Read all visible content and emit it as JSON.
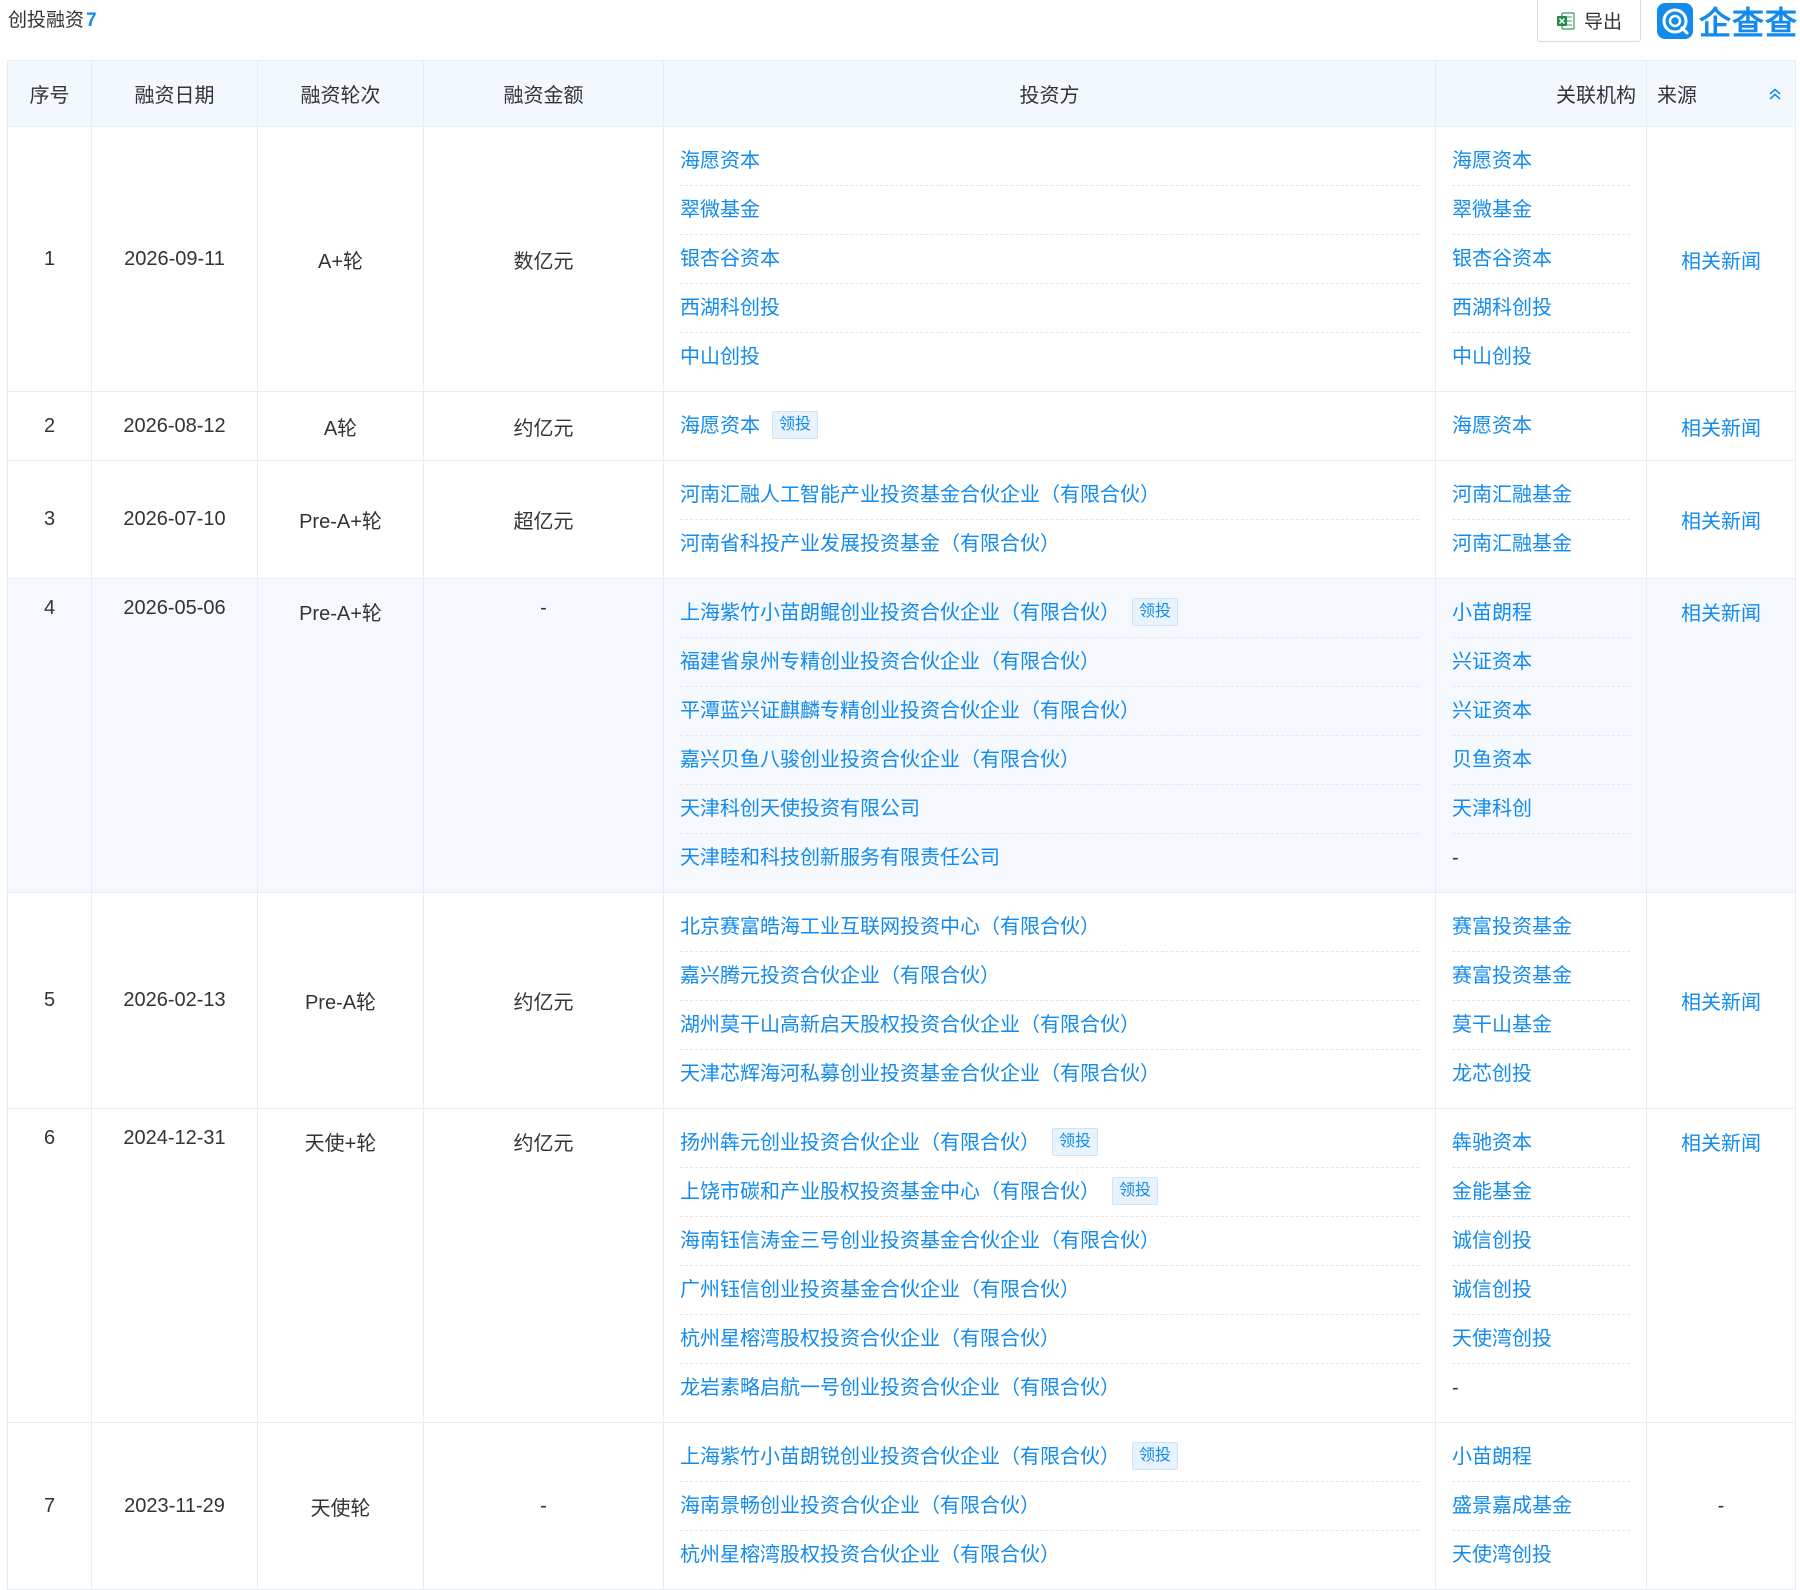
{
  "header": {
    "title": "创投融资",
    "count": "7",
    "export_label": "导出",
    "brand": "企查查"
  },
  "columns": [
    "序号",
    "融资日期",
    "融资轮次",
    "融资金额",
    "投资方",
    "关联机构",
    "来源"
  ],
  "rows": [
    {
      "index": "1",
      "date": "2026-09-11",
      "round": "A+轮",
      "amount": "数亿元",
      "source": "相关新闻",
      "investors": [
        {
          "name": "海愿资本",
          "tag": ""
        },
        {
          "name": "翠微基金",
          "tag": ""
        },
        {
          "name": "银杏谷资本",
          "tag": ""
        },
        {
          "name": "西湖科创投",
          "tag": ""
        },
        {
          "name": "中山创投",
          "tag": ""
        }
      ],
      "orgs": [
        "海愿资本",
        "翠微基金",
        "银杏谷资本",
        "西湖科创投",
        "中山创投"
      ]
    },
    {
      "index": "2",
      "date": "2026-08-12",
      "round": "A轮",
      "amount": "约亿元",
      "source": "相关新闻",
      "investors": [
        {
          "name": "海愿资本",
          "tag": "领投"
        }
      ],
      "orgs": [
        "海愿资本"
      ]
    },
    {
      "index": "3",
      "date": "2026-07-10",
      "round": "Pre-A+轮",
      "amount": "超亿元",
      "source": "相关新闻",
      "investors": [
        {
          "name": "河南汇融人工智能产业投资基金合伙企业（有限合伙）",
          "tag": ""
        },
        {
          "name": "河南省科投产业发展投资基金（有限合伙）",
          "tag": ""
        }
      ],
      "orgs": [
        "河南汇融基金",
        "河南汇融基金"
      ]
    },
    {
      "index": "4",
      "date": "2026-05-06",
      "round": "Pre-A+轮",
      "amount": "-",
      "source": "相关新闻",
      "investors": [
        {
          "name": "上海紫竹小苗朗鲲创业投资合伙企业（有限合伙）",
          "tag": "领投"
        },
        {
          "name": "福建省泉州专精创业投资合伙企业（有限合伙）",
          "tag": ""
        },
        {
          "name": "平潭蓝兴证麒麟专精创业投资合伙企业（有限合伙）",
          "tag": ""
        },
        {
          "name": "嘉兴贝鱼八骏创业投资合伙企业（有限合伙）",
          "tag": ""
        },
        {
          "name": "天津科创天使投资有限公司",
          "tag": ""
        },
        {
          "name": "天津睦和科技创新服务有限责任公司",
          "tag": ""
        }
      ],
      "orgs": [
        "小苗朗程",
        "兴证资本",
        "兴证资本",
        "贝鱼资本",
        "天津科创",
        "-"
      ]
    },
    {
      "index": "5",
      "date": "2026-02-13",
      "round": "Pre-A轮",
      "amount": "约亿元",
      "source": "相关新闻",
      "investors": [
        {
          "name": "北京赛富皓海工业互联网投资中心（有限合伙）",
          "tag": ""
        },
        {
          "name": "嘉兴腾元投资合伙企业（有限合伙）",
          "tag": ""
        },
        {
          "name": "湖州莫干山高新启天股权投资合伙企业（有限合伙）",
          "tag": ""
        },
        {
          "name": "天津芯辉海河私募创业投资基金合伙企业（有限合伙）",
          "tag": ""
        }
      ],
      "orgs": [
        "赛富投资基金",
        "赛富投资基金",
        "莫干山基金",
        "龙芯创投"
      ]
    },
    {
      "index": "6",
      "date": "2024-12-31",
      "round": "天使+轮",
      "amount": "约亿元",
      "source": "相关新闻",
      "investors": [
        {
          "name": "扬州犇元创业投资合伙企业（有限合伙）",
          "tag": "领投"
        },
        {
          "name": "上饶市碳和产业股权投资基金中心（有限合伙）",
          "tag": "领投"
        },
        {
          "name": "海南钰信涛金三号创业投资基金合伙企业（有限合伙）",
          "tag": ""
        },
        {
          "name": "广州钰信创业投资基金合伙企业（有限合伙）",
          "tag": ""
        },
        {
          "name": "杭州星榕湾股权投资合伙企业（有限合伙）",
          "tag": ""
        },
        {
          "name": "龙岩素略启航一号创业投资合伙企业（有限合伙）",
          "tag": ""
        }
      ],
      "orgs": [
        "犇驰资本",
        "金能基金",
        "诚信创投",
        "诚信创投",
        "天使湾创投",
        "-"
      ]
    },
    {
      "index": "7",
      "date": "2023-11-29",
      "round": "天使轮",
      "amount": "-",
      "source": "-",
      "investors": [
        {
          "name": "上海紫竹小苗朗锐创业投资合伙企业（有限合伙）",
          "tag": "领投"
        },
        {
          "name": "海南景畅创业投资合伙企业（有限合伙）",
          "tag": ""
        },
        {
          "name": "杭州星榕湾股权投资合伙企业（有限合伙）",
          "tag": ""
        }
      ],
      "orgs": [
        "小苗朗程",
        "盛景嘉成基金",
        "天使湾创投"
      ]
    }
  ],
  "highlight_row": "4",
  "icons": {
    "export": "excel-icon",
    "brand": "qcc-logo-icon",
    "collapse": "chevron-up-icon"
  },
  "colors": {
    "link": "#128bed",
    "header_bg": "#f2f8fe",
    "border": "#e4eef6"
  }
}
